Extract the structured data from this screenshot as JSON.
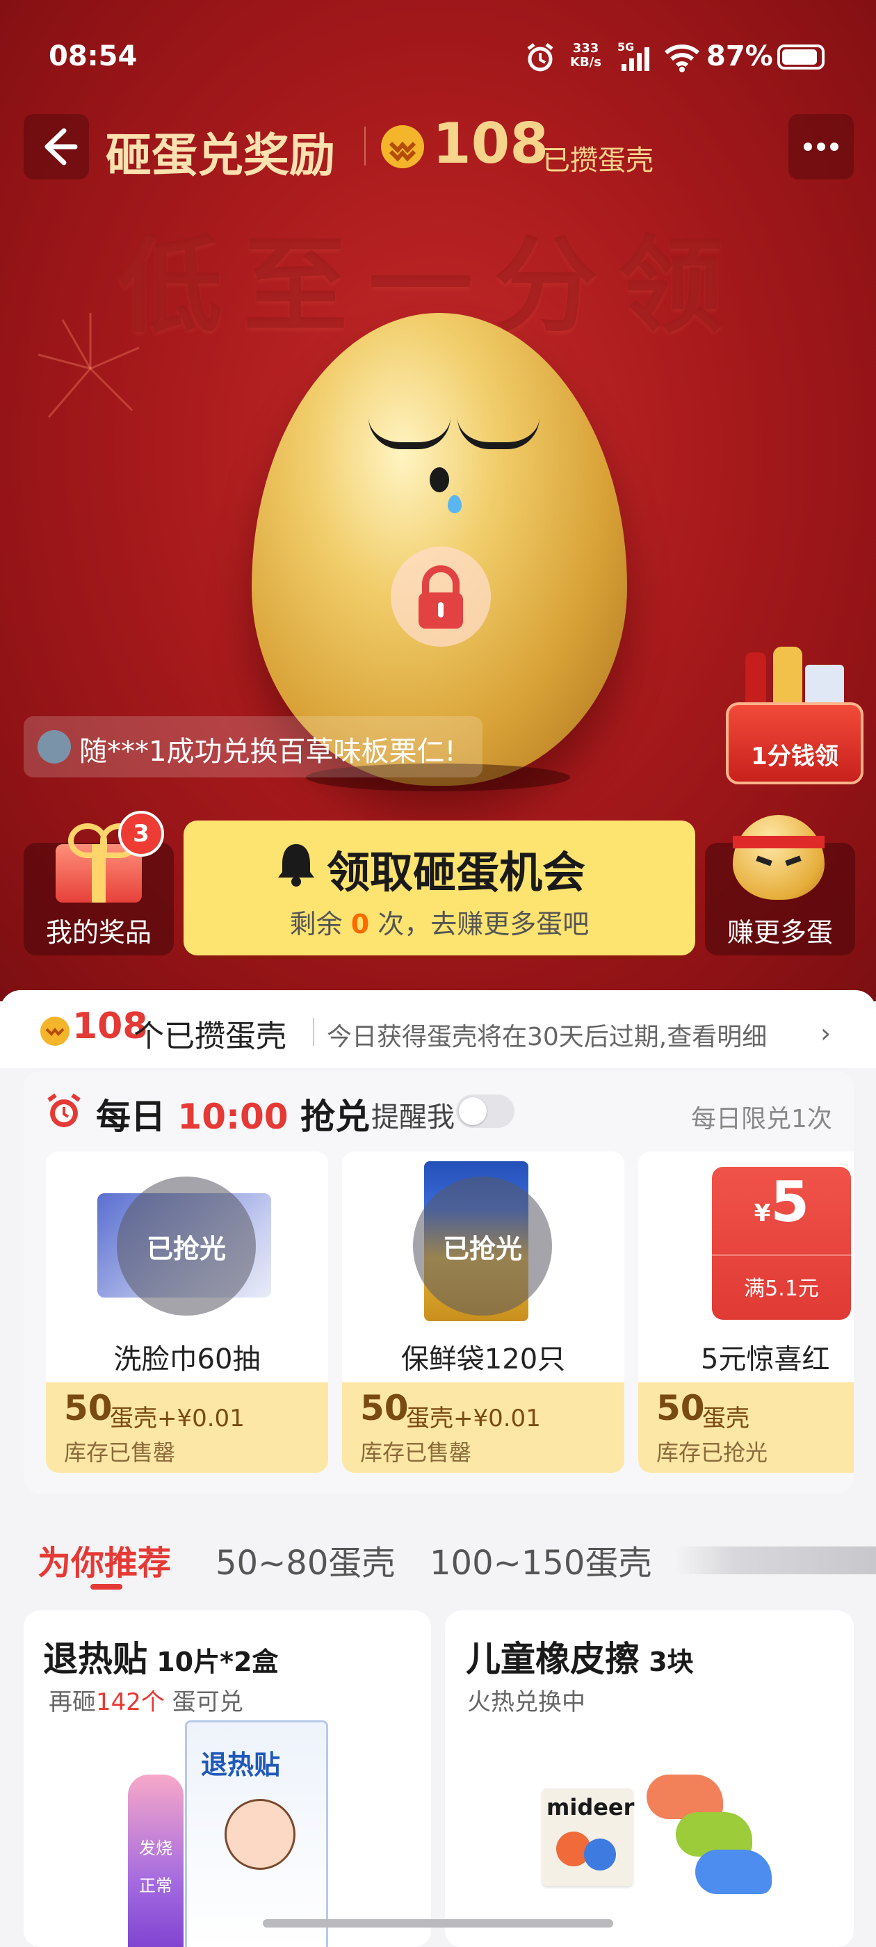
{
  "status_bar": {
    "time": "08:54",
    "net_speed_top": "333",
    "net_speed_bottom": "KB/s",
    "net_type": "5G",
    "battery": "87%"
  },
  "header": {
    "title": "砸蛋兑奖励",
    "shell_count": "108",
    "shell_label": "已攒蛋壳"
  },
  "hero": {
    "watermark": "低至一分领",
    "ticker": "随***1成功兑换百草味板栗仁!",
    "basket_label": "1分钱领"
  },
  "actions": {
    "prizes_label": "我的奖品",
    "prizes_badge": "3",
    "main_title": "领取砸蛋机会",
    "main_sub_prefix": "剩余 ",
    "main_sub_count": "0",
    "main_sub_suffix": " 次，去赚更多蛋吧",
    "earn_label": "赚更多蛋"
  },
  "summary": {
    "count": "108",
    "label": " 个已攒蛋壳",
    "note": "今日获得蛋壳将在30天后过期,查看明细"
  },
  "flash": {
    "prefix": "每日 ",
    "time": "10:00",
    "suffix": " 抢兑",
    "remind": "提醒我",
    "limit": "每日限兑1次",
    "items": [
      {
        "name": "洗脸巾60抽",
        "price": "50",
        "price_unit": "蛋壳+¥0.01",
        "stock": "库存已售罄",
        "overlay": "已抢光"
      },
      {
        "name": "保鲜袋120只",
        "price": "50",
        "price_unit": "蛋壳+¥0.01",
        "stock": "库存已售罄",
        "overlay": "已抢光"
      },
      {
        "name": "5元惊喜红",
        "price": "50",
        "price_unit": "蛋壳",
        "stock": "库存已抢光",
        "coupon_value": "5",
        "coupon_symbol": "¥",
        "coupon_cond": "满5.1元"
      }
    ]
  },
  "tabs": [
    "为你推荐",
    "50~80蛋壳",
    "100~150蛋壳"
  ],
  "recommend": [
    {
      "title": "退热贴",
      "spec": "10片*2盒",
      "sub_prefix": "再砸",
      "sub_count": "142个",
      "sub_suffix": " 蛋可兑",
      "pkg_brand": "退热贴",
      "pkg_side1": "发烧",
      "pkg_side2": "正常"
    },
    {
      "title": "儿童橡皮擦",
      "spec": "3块",
      "sub": "火热兑换中",
      "brand": "mideer"
    }
  ],
  "colors": {
    "hero_red": "#a81a1c",
    "gold": "#f7d48c",
    "accent_red": "#e53935",
    "yellow": "#fde36f"
  }
}
